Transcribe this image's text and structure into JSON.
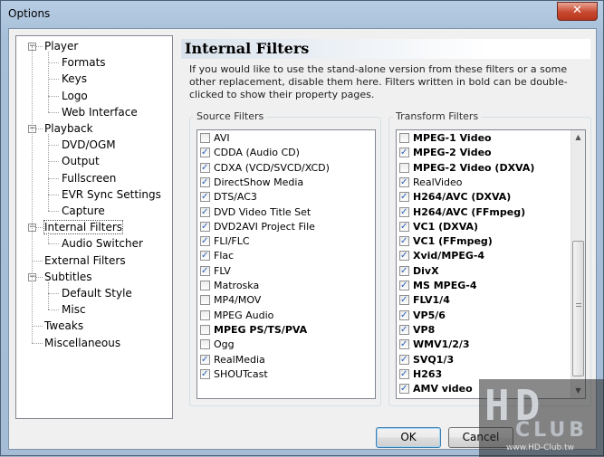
{
  "window": {
    "title": "Options",
    "close_glyph": "✕"
  },
  "tree": {
    "items": [
      {
        "label": "Player",
        "level": 0,
        "expanded": true
      },
      {
        "label": "Formats",
        "level": 1
      },
      {
        "label": "Keys",
        "level": 1
      },
      {
        "label": "Logo",
        "level": 1
      },
      {
        "label": "Web Interface",
        "level": 1
      },
      {
        "label": "Playback",
        "level": 0,
        "expanded": true
      },
      {
        "label": "DVD/OGM",
        "level": 1
      },
      {
        "label": "Output",
        "level": 1
      },
      {
        "label": "Fullscreen",
        "level": 1
      },
      {
        "label": "EVR Sync Settings",
        "level": 1
      },
      {
        "label": "Capture",
        "level": 1
      },
      {
        "label": "Internal Filters",
        "level": 0,
        "expanded": true,
        "selected": true
      },
      {
        "label": "Audio Switcher",
        "level": 1
      },
      {
        "label": "External Filters",
        "level": 0
      },
      {
        "label": "Subtitles",
        "level": 0,
        "expanded": true
      },
      {
        "label": "Default Style",
        "level": 1
      },
      {
        "label": "Misc",
        "level": 1
      },
      {
        "label": "Tweaks",
        "level": 0
      },
      {
        "label": "Miscellaneous",
        "level": 0
      }
    ]
  },
  "page": {
    "title": "Internal Filters",
    "description": "If you would like to use the stand-alone version from these filters or a some other replacement, disable them here. Filters written in bold can be double-clicked to show their property pages."
  },
  "source_filters": {
    "label": "Source Filters",
    "items": [
      {
        "label": "AVI",
        "checked": false,
        "bold": false
      },
      {
        "label": "CDDA (Audio CD)",
        "checked": true,
        "bold": false
      },
      {
        "label": "CDXA (VCD/SVCD/XCD)",
        "checked": true,
        "bold": false
      },
      {
        "label": "DirectShow Media",
        "checked": true,
        "bold": false
      },
      {
        "label": "DTS/AC3",
        "checked": true,
        "bold": false
      },
      {
        "label": "DVD Video Title Set",
        "checked": true,
        "bold": false
      },
      {
        "label": "DVD2AVI Project File",
        "checked": true,
        "bold": false
      },
      {
        "label": "FLI/FLC",
        "checked": true,
        "bold": false
      },
      {
        "label": "Flac",
        "checked": true,
        "bold": false
      },
      {
        "label": "FLV",
        "checked": true,
        "bold": false
      },
      {
        "label": "Matroska",
        "checked": false,
        "bold": false
      },
      {
        "label": "MP4/MOV",
        "checked": false,
        "bold": false
      },
      {
        "label": "MPEG Audio",
        "checked": false,
        "bold": false
      },
      {
        "label": "MPEG PS/TS/PVA",
        "checked": false,
        "bold": true
      },
      {
        "label": "Ogg",
        "checked": false,
        "bold": false
      },
      {
        "label": "RealMedia",
        "checked": true,
        "bold": false
      },
      {
        "label": "SHOUTcast",
        "checked": true,
        "bold": false
      }
    ]
  },
  "transform_filters": {
    "label": "Transform Filters",
    "items": [
      {
        "label": "MPEG-1 Video",
        "checked": false,
        "bold": true
      },
      {
        "label": "MPEG-2 Video",
        "checked": true,
        "bold": true
      },
      {
        "label": "MPEG-2 Video (DXVA)",
        "checked": false,
        "bold": true
      },
      {
        "label": "RealVideo",
        "checked": true,
        "bold": false
      },
      {
        "label": "H264/AVC (DXVA)",
        "checked": true,
        "bold": true
      },
      {
        "label": "H264/AVC (FFmpeg)",
        "checked": true,
        "bold": true
      },
      {
        "label": "VC1 (DXVA)",
        "checked": true,
        "bold": true
      },
      {
        "label": "VC1 (FFmpeg)",
        "checked": true,
        "bold": true
      },
      {
        "label": "Xvid/MPEG-4",
        "checked": true,
        "bold": true
      },
      {
        "label": "DivX",
        "checked": true,
        "bold": true
      },
      {
        "label": "MS MPEG-4",
        "checked": true,
        "bold": true
      },
      {
        "label": "FLV1/4",
        "checked": true,
        "bold": true
      },
      {
        "label": "VP5/6",
        "checked": true,
        "bold": true
      },
      {
        "label": "VP8",
        "checked": true,
        "bold": true
      },
      {
        "label": "WMV1/2/3",
        "checked": true,
        "bold": true
      },
      {
        "label": "SVQ1/3",
        "checked": true,
        "bold": true
      },
      {
        "label": "H263",
        "checked": true,
        "bold": true
      },
      {
        "label": "AMV video",
        "checked": true,
        "bold": true
      }
    ]
  },
  "buttons": {
    "ok": "OK",
    "cancel": "Cancel"
  },
  "watermark": {
    "hd": "HD",
    "club": "CLUB",
    "url": "www.HD-Club.tw"
  }
}
